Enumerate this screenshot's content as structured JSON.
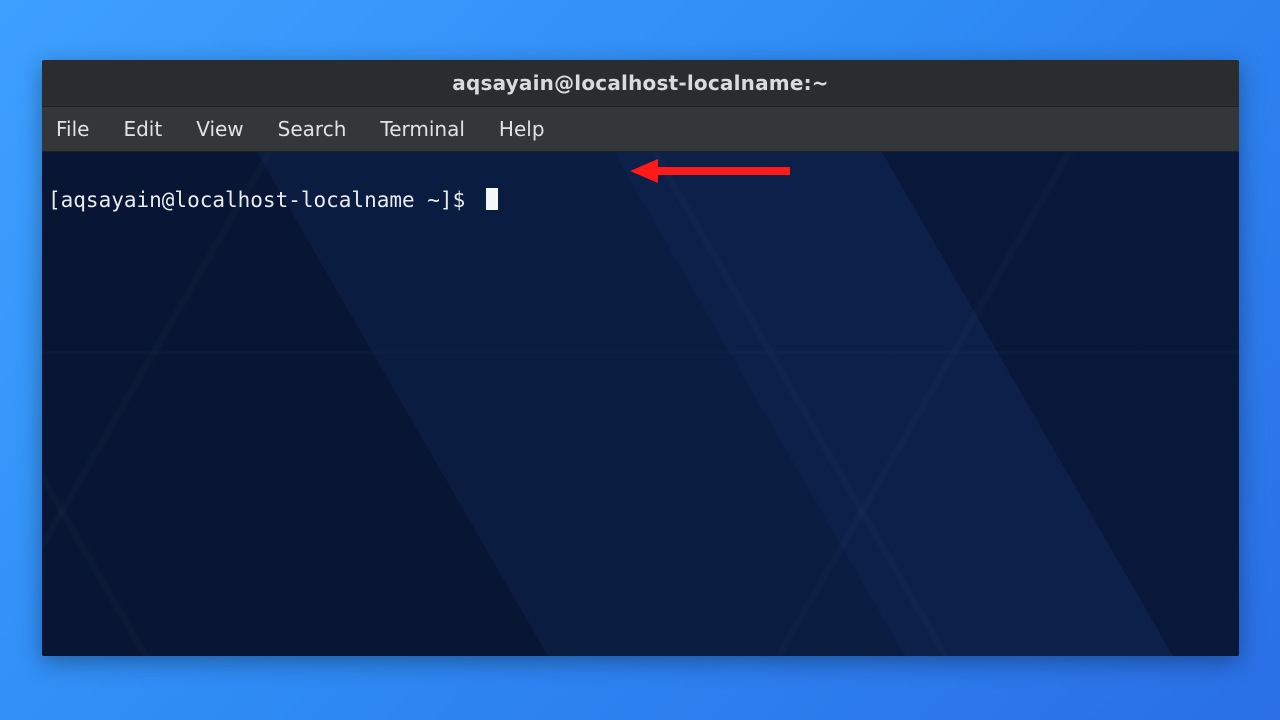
{
  "window": {
    "title": "aqsayain@localhost-localname:~"
  },
  "menubar": {
    "items": [
      "File",
      "Edit",
      "View",
      "Search",
      "Terminal",
      "Help"
    ]
  },
  "terminal": {
    "prompt": "[aqsayain@localhost-localname ~]$ "
  },
  "annotation": {
    "arrow_color": "#ff1a1a"
  }
}
